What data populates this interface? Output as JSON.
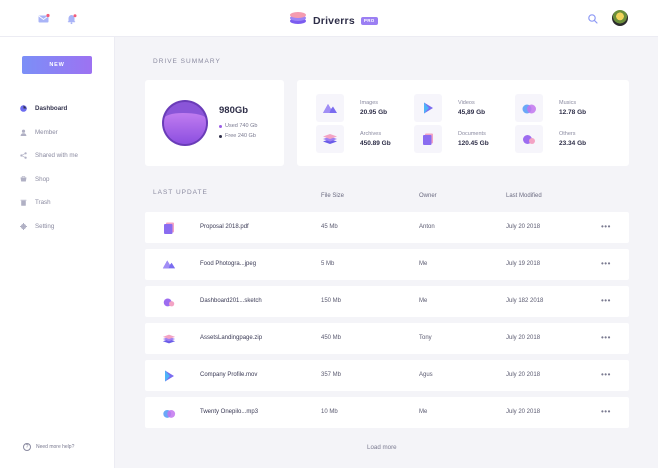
{
  "header": {
    "app_name": "Driverrs",
    "badge": "PRO",
    "icons": [
      "mail-icon",
      "bell-icon",
      "search-icon",
      "avatar"
    ],
    "accent_color": "#9b7ff3"
  },
  "sidebar": {
    "new_button": "NEW",
    "items": [
      {
        "label": "Dashboard",
        "icon": "dashboard-icon",
        "active": true
      },
      {
        "label": "Member",
        "icon": "user-icon",
        "active": false
      },
      {
        "label": "Shared with me",
        "icon": "share-icon",
        "active": false
      },
      {
        "label": "Shop",
        "icon": "cart-icon",
        "active": false
      },
      {
        "label": "Trash",
        "icon": "trash-icon",
        "active": false
      },
      {
        "label": "Setting",
        "icon": "gear-icon",
        "active": false
      }
    ],
    "help": "Need more help?"
  },
  "summary": {
    "title": "DRIVE SUMMARY",
    "total": "980Gb",
    "used": "Used 740 Gb",
    "free": "Free 240 Gb",
    "used_color": "#9b5de5",
    "free_color": "#2e2e48",
    "categories": [
      {
        "label": "Images",
        "size": "20.95 Gb",
        "icon": "image-icon"
      },
      {
        "label": "Videos",
        "size": "45,89 Gb",
        "icon": "video-icon"
      },
      {
        "label": "Musics",
        "size": "12.78 Gb",
        "icon": "music-icon"
      },
      {
        "label": "Archives",
        "size": "450.89 Gb",
        "icon": "archive-icon"
      },
      {
        "label": "Documents",
        "size": "120.45 Gb",
        "icon": "document-icon"
      },
      {
        "label": "Others",
        "size": "23.34 Gb",
        "icon": "other-icon"
      }
    ]
  },
  "table": {
    "title": "LAST UPDATE",
    "columns": [
      "File Size",
      "Owner",
      "Last Modified"
    ],
    "rows": [
      {
        "name": "Proposal 2018.pdf",
        "size": "45 Mb",
        "owner": "Anton",
        "modified": "July 20 2018",
        "icon": "document-icon"
      },
      {
        "name": "Food Photogra...jpeg",
        "size": "5 Mb",
        "owner": "Me",
        "modified": "July 19 2018",
        "icon": "image-icon"
      },
      {
        "name": "Dashboard201...sketch",
        "size": "150 Mb",
        "owner": "Me",
        "modified": "July 182 2018",
        "icon": "other-icon"
      },
      {
        "name": "AssetsLandingpage.zip",
        "size": "450 Mb",
        "owner": "Tony",
        "modified": "July 20 2018",
        "icon": "archive-icon"
      },
      {
        "name": "Company Profile.mov",
        "size": "357 Mb",
        "owner": "Agus",
        "modified": "July 20 2018",
        "icon": "video-icon"
      },
      {
        "name": "Twenty Onepilo...mp3",
        "size": "10 Mb",
        "owner": "Me",
        "modified": "July 20 2018",
        "icon": "music-icon"
      }
    ],
    "more_label": "•••",
    "load_more": "Load more"
  }
}
